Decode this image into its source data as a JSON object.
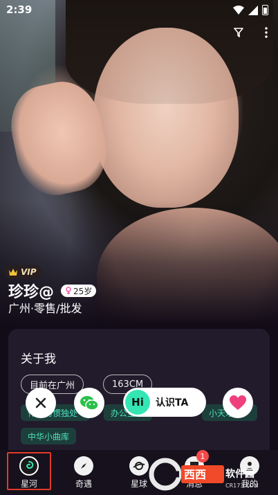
{
  "status_bar": {
    "time": "2:39"
  },
  "profile": {
    "vip_label": "VIP",
    "name": "珍珍@",
    "age": "25岁",
    "location_line": "广州·零售/批发"
  },
  "about": {
    "title": "关于我",
    "info_tags": [
      "目前在广州",
      "163CM"
    ],
    "interest_tags": [
      "作息习惯独处",
      "办公室",
      "小天才",
      "中华小曲库"
    ]
  },
  "actions": {
    "hi_text": "Hi",
    "hi_label": "认识TA"
  },
  "tabs": [
    {
      "label": "星河",
      "active": true
    },
    {
      "label": "奇遇"
    },
    {
      "label": "星球"
    },
    {
      "label": "消息",
      "badge": "1"
    },
    {
      "label": "我的"
    }
  ],
  "watermark": {
    "text": "西西软件园",
    "subtext": "CR173.COM"
  },
  "colors": {
    "accent": "#34e6b4",
    "active_outline": "#e23a2c",
    "card_bg": "#221b2c"
  }
}
